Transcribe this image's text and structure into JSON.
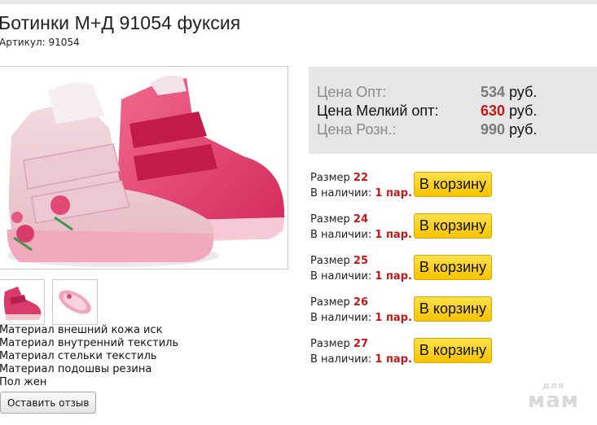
{
  "product": {
    "title": "Ботинки М+Д 91054 фуксия",
    "sku_text": "Артикул: 91054",
    "image_alt": "Детские ботинки на липучках, розовые и фуксия",
    "thumbnails": [
      "thumb-side",
      "thumb-sole"
    ]
  },
  "prices": [
    {
      "label": "Цена Опт:",
      "value": "534",
      "unit": "руб.",
      "style": "muted"
    },
    {
      "label": "Цена Мелкий опт:",
      "value": "630",
      "unit": "руб.",
      "style": "highlight"
    },
    {
      "label": "Цена Розн.:",
      "value": "990",
      "unit": "руб.",
      "style": "muted"
    }
  ],
  "sizes": [
    {
      "size_label": "Размер",
      "size": "22",
      "stock_label": "В наличии:",
      "stock": "1 пар.",
      "button": "В корзину"
    },
    {
      "size_label": "Размер",
      "size": "24",
      "stock_label": "В наличии:",
      "stock": "1 пар.",
      "button": "В корзину"
    },
    {
      "size_label": "Размер",
      "size": "25",
      "stock_label": "В наличии:",
      "stock": "1 пар.",
      "button": "В корзину"
    },
    {
      "size_label": "Размер",
      "size": "26",
      "stock_label": "В наличии:",
      "stock": "1 пар.",
      "button": "В корзину"
    },
    {
      "size_label": "Размер",
      "size": "27",
      "stock_label": "В наличии:",
      "stock": "1 пар.",
      "button": "В корзину"
    }
  ],
  "specs": [
    "Материал внешний кожа иск",
    "Материал внутренний текстиль",
    "Материал стельки текстиль",
    "Материал подошвы резина",
    "Пол жен"
  ],
  "review_button": "Оставить отзыв",
  "watermark": {
    "line1": "для",
    "line2": "мам"
  },
  "colors": {
    "price_muted": "#8a8a8a",
    "price_value_muted": "#7a7a7a",
    "highlight": "#c21818",
    "cart_button": "#f6c400",
    "price_box_bg": "#e6e6e6"
  }
}
